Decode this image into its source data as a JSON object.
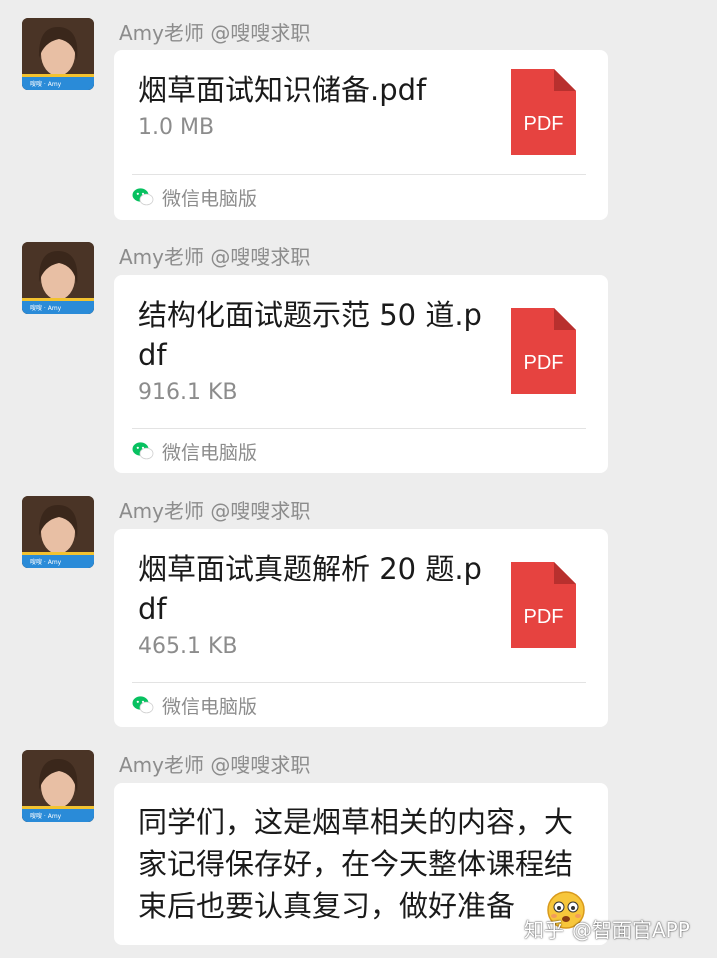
{
  "messages": [
    {
      "sender": "Amy老师 @嗖嗖求职",
      "type": "file",
      "file_name": "烟草面试知识储备.pdf",
      "file_size": "1.0 MB",
      "file_icon_label": "PDF",
      "source": "微信电脑版"
    },
    {
      "sender": "Amy老师 @嗖嗖求职",
      "type": "file",
      "file_name": "结构化面试题示范 50 道.pdf",
      "file_size": "916.1 KB",
      "file_icon_label": "PDF",
      "source": "微信电脑版"
    },
    {
      "sender": "Amy老师 @嗖嗖求职",
      "type": "file",
      "file_name": "烟草面试真题解析 20 题.pdf",
      "file_size": "465.1 KB",
      "file_icon_label": "PDF",
      "source": "微信电脑版"
    },
    {
      "sender": "Amy老师 @嗖嗖求职",
      "type": "text",
      "text": "同学们，这是烟草相关的内容，大家记得保存好，在今天整体课程结束后也要认真复习，做好准备"
    }
  ],
  "watermark": {
    "site": "知乎",
    "handle": "@智面官APP"
  },
  "colors": {
    "background": "#ededed",
    "bubble": "#ffffff",
    "pdf_red": "#e64340",
    "wechat_green": "#07c160",
    "secondary_text": "#8c8c8c"
  },
  "icons": {
    "file": "pdf-file-icon",
    "source": "wechat-icon",
    "emoji": "embarrassed-emoji-icon"
  }
}
